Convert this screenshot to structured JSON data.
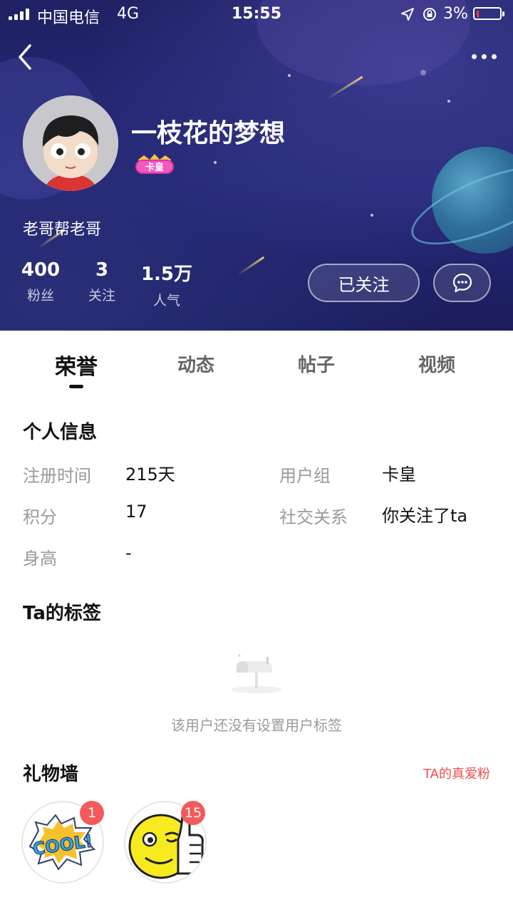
{
  "status_bar": {
    "carrier": "中国电信",
    "network": "4G",
    "time": "15:55",
    "battery": "3%",
    "battery_level": 0.03
  },
  "profile": {
    "nickname": "一枝花的梦想",
    "badge_label": "卡皇",
    "signature": "老哥帮老哥",
    "stats": [
      {
        "value": "400",
        "label": "粉丝"
      },
      {
        "value": "3",
        "label": "关注"
      },
      {
        "value": "1.5万",
        "label": "人气"
      }
    ],
    "follow_button": "已关注"
  },
  "tabs": [
    {
      "label": "荣誉",
      "active": true
    },
    {
      "label": "动态",
      "active": false
    },
    {
      "label": "帖子",
      "active": false
    },
    {
      "label": "视频",
      "active": false
    }
  ],
  "personal_info": {
    "title": "个人信息",
    "rows": [
      {
        "label": "注册时间",
        "value": "215天"
      },
      {
        "label": "用户组",
        "value": "卡皇"
      },
      {
        "label": "积分",
        "value": "17"
      },
      {
        "label": "社交关系",
        "value": "你关注了ta"
      },
      {
        "label": "身高",
        "value": "-"
      }
    ]
  },
  "tags": {
    "title": "Ta的标签",
    "empty_text": "该用户还没有设置用户标签"
  },
  "gifts": {
    "title": "礼物墙",
    "link": "TA的真爱粉",
    "items": [
      {
        "name": "cool-sticker-gift",
        "count": "1",
        "image_text": "COOL!"
      },
      {
        "name": "thumbs-up-smiley-gift",
        "count": "15"
      }
    ]
  },
  "colors": {
    "header_bg": "#1f2163",
    "accent_red": "#f04e4e",
    "badge_red": "#f5595a"
  }
}
